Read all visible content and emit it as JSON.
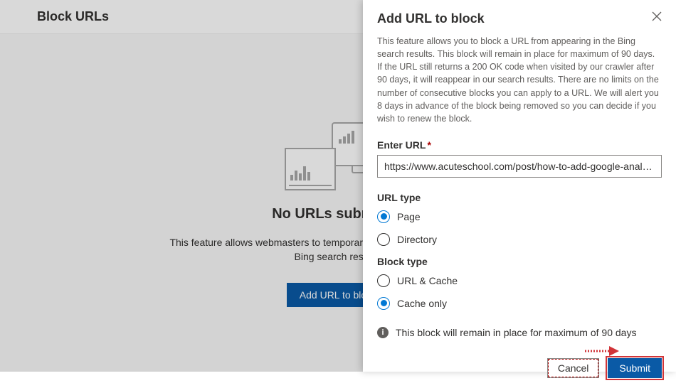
{
  "bg": {
    "header_title": "Block URLs",
    "empty_title": "No URLs submitted",
    "empty_desc_l1": "This feature allows webmasters to temporarily block URLs from appearing in",
    "empty_desc_l2": "Bing search results.",
    "add_button": "Add URL to block"
  },
  "panel": {
    "title": "Add URL to block",
    "description": "This feature allows you to block a URL from appearing in the Bing search results. This block will remain in place for maximum of 90 days. If the URL still returns a 200 OK code when visited by our crawler after 90 days, it will reappear in our search results. There are no limits on the number of consecutive blocks you can apply to a URL. We will alert you 8 days in advance of the block being removed so you can decide if you wish to renew the block.",
    "url_field": {
      "label": "Enter URL",
      "required_marker": "*",
      "value": "https://www.acuteschool.com/post/how-to-add-google-analyti ..."
    },
    "url_type": {
      "label": "URL type",
      "options": {
        "page": "Page",
        "directory": "Directory"
      },
      "selected": "page"
    },
    "block_type": {
      "label": "Block type",
      "options": {
        "url_cache": "URL & Cache",
        "cache_only": "Cache only"
      },
      "selected": "cache_only"
    },
    "info_text": "This block will remain in place for maximum of 90 days",
    "buttons": {
      "cancel": "Cancel",
      "submit": "Submit"
    }
  },
  "colors": {
    "accent": "#0078d4",
    "primary_btn": "#0a5aa6",
    "annotation": "#d13438"
  }
}
